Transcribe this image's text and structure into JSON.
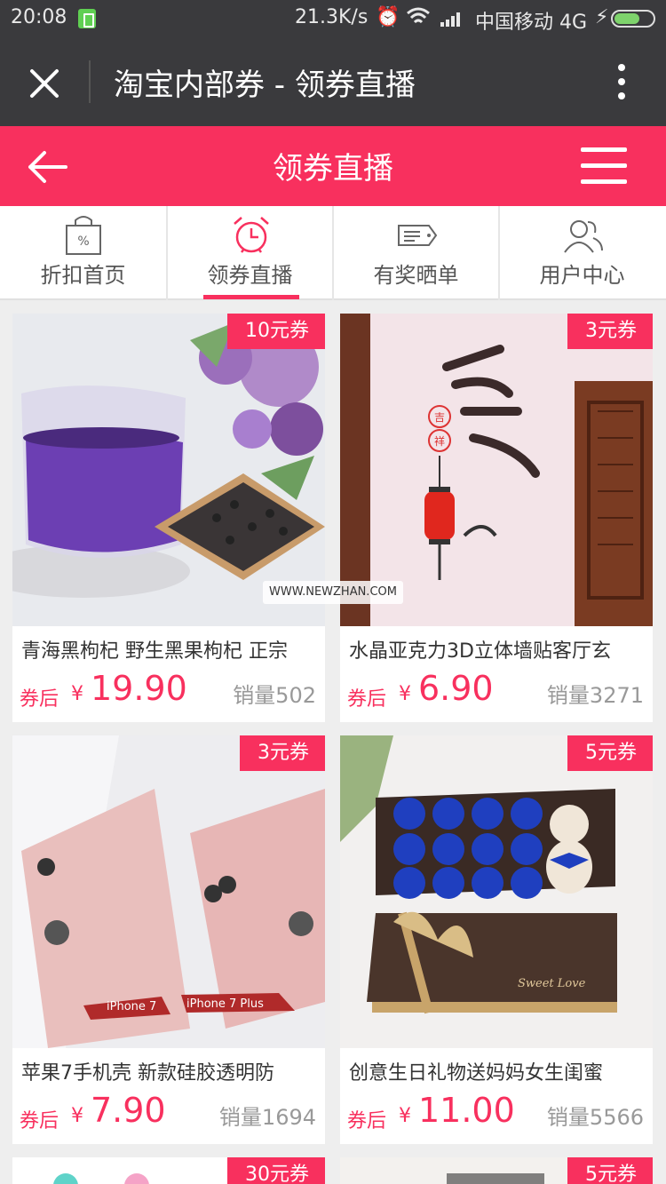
{
  "status_bar": {
    "time": "20:08",
    "speed": "21.3K/s",
    "carrier": "中国移动 4G",
    "icons": [
      "battery-saver-icon",
      "alarm-icon",
      "wifi-icon",
      "signal-icon",
      "charging-icon",
      "battery-icon"
    ]
  },
  "titlebar": {
    "title": "淘宝内部券 - 领券直播"
  },
  "header": {
    "title": "领券直播"
  },
  "tabs": [
    {
      "label": "折扣首页",
      "icon": "discount-bag-icon"
    },
    {
      "label": "领券直播",
      "icon": "alarm-clock-icon",
      "active": true
    },
    {
      "label": "有奖晒单",
      "icon": "ticket-icon"
    },
    {
      "label": "用户中心",
      "icon": "users-icon"
    }
  ],
  "products": [
    {
      "coupon": "10元券",
      "name": "青海黑枸杞 野生黑果枸杞 正宗",
      "after": "券后",
      "yen": "¥",
      "price": "19.90",
      "sales": "销量502"
    },
    {
      "coupon": "3元券",
      "name": "水晶亚克力3D立体墙贴客厅玄",
      "after": "券后",
      "yen": "¥",
      "price": "6.90",
      "sales": "销量3271"
    },
    {
      "coupon": "3元券",
      "name": "苹果7手机壳 新款硅胶透明防",
      "after": "券后",
      "yen": "¥",
      "price": "7.90",
      "sales": "销量1694"
    },
    {
      "coupon": "5元券",
      "name": "创意生日礼物送妈妈女生闺蜜",
      "after": "券后",
      "yen": "¥",
      "price": "11.00",
      "sales": "销量5566"
    },
    {
      "coupon": "30元券"
    },
    {
      "coupon": "5元券"
    }
  ],
  "image_text": {
    "iphone_label_1": "iPhone 7",
    "iphone_label_2": "iPhone 7 Plus",
    "gift_box_text": "Sweet Love",
    "wall_char_small_1": "吉",
    "wall_char_small_2": "祥",
    "watermark": "WWW.NEWZHAN.COM"
  },
  "colors": {
    "accent": "#f8305e",
    "titlebar": "#3a3a3d",
    "background": "#eeeeee"
  }
}
